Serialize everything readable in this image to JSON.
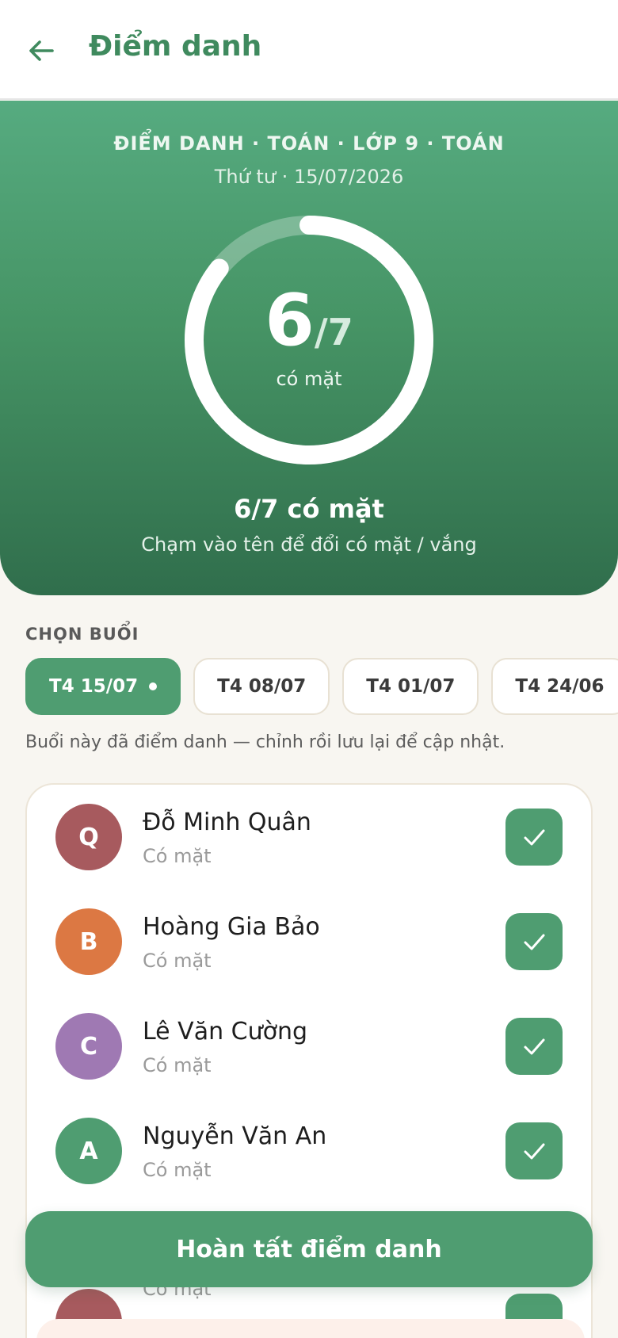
{
  "appbar": {
    "title": "Điểm danh",
    "back_icon": "arrow-left-icon"
  },
  "hero": {
    "heading": "ĐIỂM DANH · TOÁN · LỚP 9 · TOÁN",
    "date": "Thứ tư · 15/07/2026",
    "present_count": "6",
    "total_label": "/7",
    "ring_label": "có mặt",
    "attendance_fraction": 0.857,
    "summary": "6/7 có mặt",
    "hint": "Chạm vào tên để đổi có mặt / vắng"
  },
  "sessions": {
    "label": "CHỌN BUỔI",
    "chips": [
      {
        "label": "T4 15/07",
        "active": true
      },
      {
        "label": "T4 08/07",
        "active": false
      },
      {
        "label": "T4 01/07",
        "active": false
      },
      {
        "label": "T4 24/06",
        "active": false
      }
    ],
    "note": "Buổi này đã điểm danh — chỉnh rồi lưu lại để cập nhật."
  },
  "students": [
    {
      "initial": "Q",
      "name": "Đỗ Minh Quân",
      "status": "Có mặt",
      "color": "#a75a5e",
      "present": true
    },
    {
      "initial": "B",
      "name": "Hoàng Gia Bảo",
      "status": "Có mặt",
      "color": "#dc7843",
      "present": true
    },
    {
      "initial": "C",
      "name": "Lê Văn Cường",
      "status": "Có mặt",
      "color": "#9f79b3",
      "present": true
    },
    {
      "initial": "A",
      "name": "Nguyễn Văn An",
      "status": "Có mặt",
      "color": "#4f9d71",
      "present": true
    }
  ],
  "partial_row_status": "Có mặt",
  "finish_button": "Hoàn tất điểm danh",
  "colors": {
    "primary": "#4f9d71",
    "title": "#3f8a5e",
    "background": "#f8f6f1"
  }
}
